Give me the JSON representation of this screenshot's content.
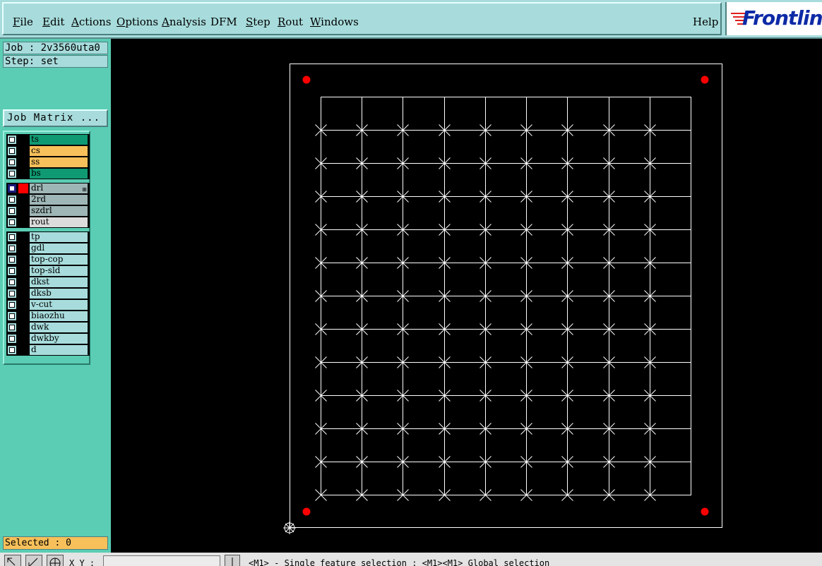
{
  "menubar": {
    "items": [
      {
        "label": "File",
        "underline": "F"
      },
      {
        "label": "Edit",
        "underline": "E"
      },
      {
        "label": "Actions",
        "underline": "A"
      },
      {
        "label": "Options",
        "underline": "O"
      },
      {
        "label": "Analysis",
        "underline": "A"
      },
      {
        "label": "DFM",
        "underline": ""
      },
      {
        "label": "Step",
        "underline": "S"
      },
      {
        "label": "Rout",
        "underline": "R"
      },
      {
        "label": "Windows",
        "underline": "W"
      }
    ],
    "help": "Help",
    "logo": "Frontline"
  },
  "panel": {
    "job": "Job : 2v3560uta0",
    "step": "Step: set",
    "job_matrix": "Job Matrix ...",
    "selected": "Selected : 0"
  },
  "layer_groups": [
    [
      {
        "name": "ts",
        "color": "#0f9a73",
        "on": false
      },
      {
        "name": "cs",
        "color": "#f7c05a",
        "on": false
      },
      {
        "name": "ss",
        "color": "#f7c05a",
        "on": false
      },
      {
        "name": "bs",
        "color": "#0f9a73",
        "on": false
      }
    ],
    [
      {
        "name": "drl",
        "color": "#9fb6b6",
        "on": true,
        "display_color": "#ff0000"
      },
      {
        "name": "2rd",
        "color": "#9fb6b6",
        "on": false
      },
      {
        "name": "szdrl",
        "color": "#9fb6b6",
        "on": false
      },
      {
        "name": "rout",
        "color": "#dcdcdc",
        "on": false
      }
    ],
    [
      {
        "name": "tp",
        "color": "#a8dcdc",
        "on": false
      },
      {
        "name": "gdl",
        "color": "#a8dcdc",
        "on": false
      },
      {
        "name": "top-cop",
        "color": "#a8dcdc",
        "on": false
      },
      {
        "name": "top-sld",
        "color": "#a8dcdc",
        "on": false
      },
      {
        "name": "dkst",
        "color": "#a8dcdc",
        "on": false
      },
      {
        "name": "dksb",
        "color": "#a8dcdc",
        "on": false
      },
      {
        "name": "v-cut",
        "color": "#a8dcdc",
        "on": false
      },
      {
        "name": "biaozhu",
        "color": "#a8dcdc",
        "on": false
      },
      {
        "name": "dwk",
        "color": "#a8dcdc",
        "on": false
      },
      {
        "name": "dwkby",
        "color": "#a8dcdc",
        "on": false
      },
      {
        "name": "d",
        "color": "#a8dcdc",
        "on": false
      }
    ]
  ],
  "colors": {
    "feature_line": "#ffffff",
    "fiducial": "#ff0000",
    "background": "#000000"
  },
  "statusbar": {
    "xy_label": "X Y :",
    "xy_value": "",
    "message": "<M1> - Single feature selection : <M1><M1> Global selection"
  }
}
